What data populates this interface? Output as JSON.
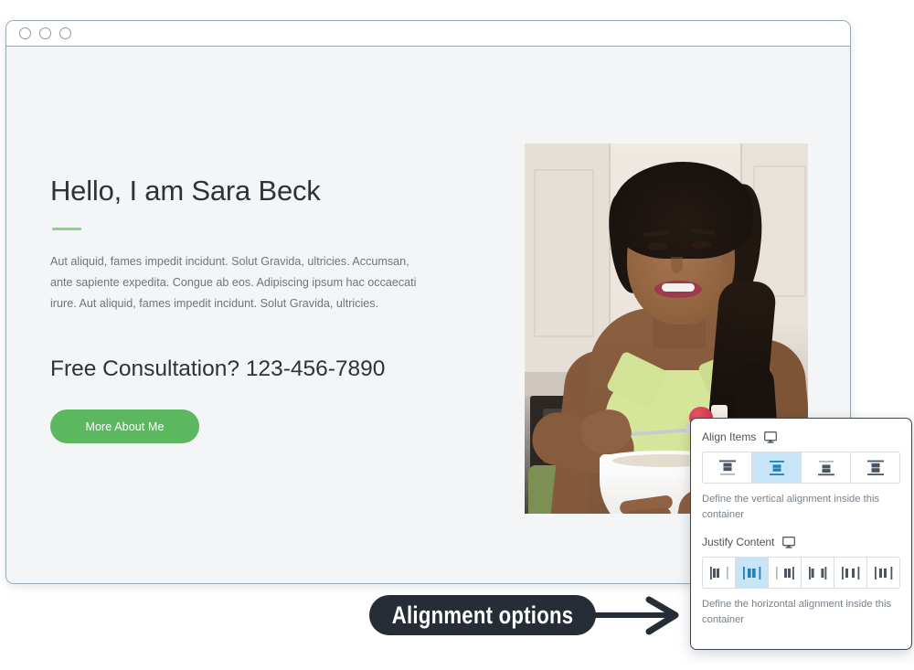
{
  "browser": {
    "traffic_lights": [
      "window-dot-1",
      "window-dot-2",
      "window-dot-3"
    ]
  },
  "hero": {
    "title": "Hello, I am Sara Beck",
    "paragraph": "Aut aliquid, fames impedit incidunt. Solut Gravida, ultricies. Accumsan, ante sapiente expedita. Congue ab eos. Adipiscing ipsum hac occaecati irure. Aut aliquid, fames impedit incidunt. Solut Gravida, ultricies.",
    "phone_line": "Free Consultation? 123-456-7890",
    "cta_label": "More About Me",
    "accent_color": "#8fd091",
    "cta_color": "#5cb85f",
    "photo_alt": "Woman in kitchen eating yogurt with a raspberry from a white bowl"
  },
  "settings_panel": {
    "align_items": {
      "label": "Align Items",
      "device_icon": "monitor-icon",
      "help": "Define the vertical alignment inside this container",
      "selected_index": 1,
      "options": [
        {
          "name": "align-flex-start",
          "icon": "align-top-icon"
        },
        {
          "name": "align-center",
          "icon": "align-middle-icon"
        },
        {
          "name": "align-flex-end",
          "icon": "align-bottom-icon"
        },
        {
          "name": "align-stretch",
          "icon": "align-stretch-icon"
        }
      ]
    },
    "justify_content": {
      "label": "Justify Content",
      "device_icon": "monitor-icon",
      "help": "Define the horizontal alignment inside this container",
      "selected_index": 1,
      "options": [
        {
          "name": "justify-flex-start",
          "icon": "justify-start-icon"
        },
        {
          "name": "justify-center",
          "icon": "justify-center-icon"
        },
        {
          "name": "justify-flex-end",
          "icon": "justify-end-icon"
        },
        {
          "name": "justify-space-between",
          "icon": "justify-between-icon"
        },
        {
          "name": "justify-space-around",
          "icon": "justify-around-icon"
        },
        {
          "name": "justify-space-evenly",
          "icon": "justify-evenly-icon"
        }
      ]
    },
    "selected_color": "#c7e5f7",
    "border_color": "#3b4652"
  },
  "callout": {
    "text": "Alignment options",
    "background": "#262d36",
    "arrow_icon": "arrow-right-icon"
  }
}
